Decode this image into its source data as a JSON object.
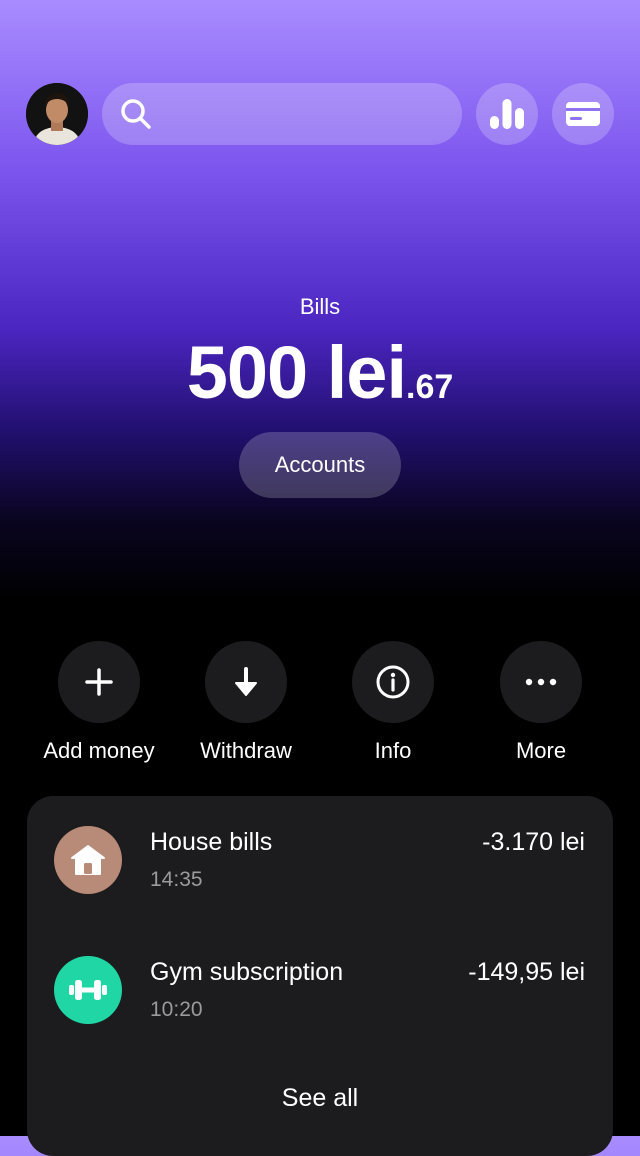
{
  "header": {
    "avatar_icon": "user-avatar",
    "search_icon": "search-icon",
    "stats_icon": "bar-chart-icon",
    "card_icon": "credit-card-icon"
  },
  "balance": {
    "label": "Bills",
    "amount": "500 lei",
    "cents": ".67",
    "accounts_button": "Accounts"
  },
  "actions": [
    {
      "label": "Add money",
      "icon": "plus-icon"
    },
    {
      "label": "Withdraw",
      "icon": "arrow-down-icon"
    },
    {
      "label": "Info",
      "icon": "info-icon"
    },
    {
      "label": "More",
      "icon": "more-icon"
    }
  ],
  "transactions": {
    "items": [
      {
        "title": "House bills",
        "time": "14:35",
        "amount": "-3.170 lei",
        "icon": "house-icon",
        "icon_color": "#b88a78"
      },
      {
        "title": "Gym subscription",
        "time": "10:20",
        "amount": "-149,95 lei",
        "icon": "dumbbell-icon",
        "icon_color": "#1fd6a4"
      }
    ],
    "see_all": "See all"
  },
  "colors": {
    "gradient_top": "#a98cff",
    "gradient_mid": "#4b25c0",
    "background": "#000000",
    "card": "#1c1c1e"
  }
}
